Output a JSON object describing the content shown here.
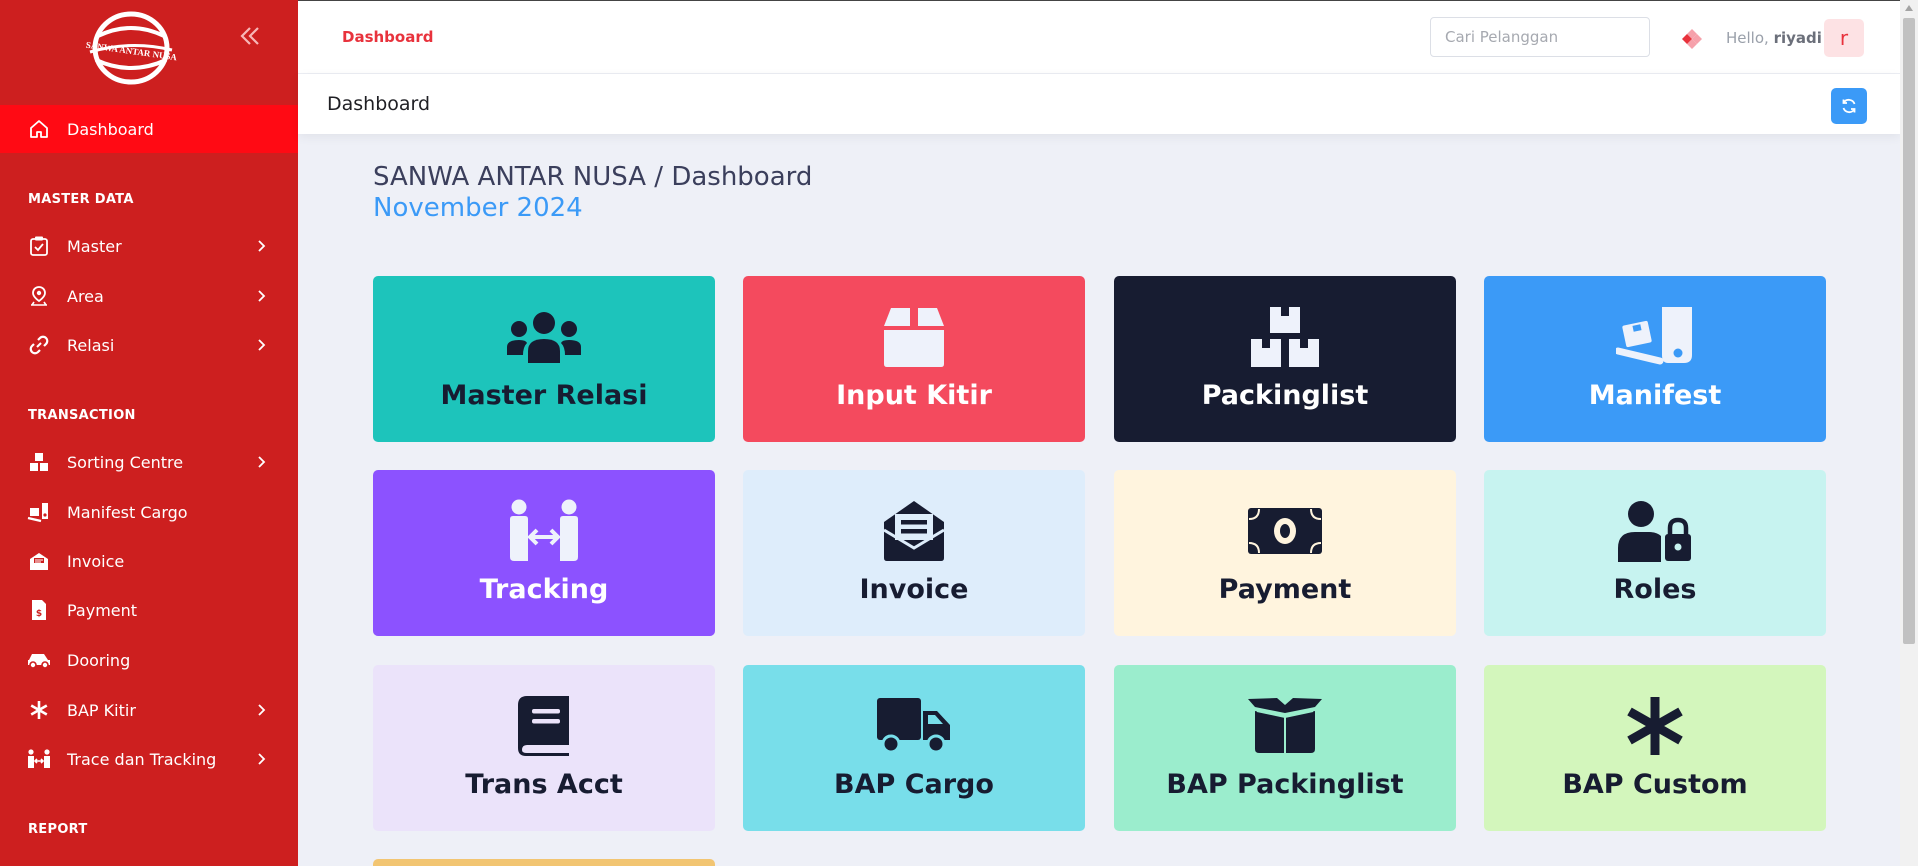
{
  "sidebar": {
    "logo_text": "SANWA ANTAR NUSA",
    "sections": {
      "master_data": "MASTER DATA",
      "transaction": "TRANSACTION",
      "report": "REPORT"
    },
    "items": {
      "dashboard": "Dashboard",
      "master": "Master",
      "area": "Area",
      "relasi": "Relasi",
      "sorting_centre": "Sorting Centre",
      "manifest_cargo": "Manifest Cargo",
      "invoice": "Invoice",
      "payment": "Payment",
      "dooring": "Dooring",
      "bap_kitir": "BAP Kitir",
      "trace_tracking": "Trace dan Tracking"
    }
  },
  "topbar": {
    "title": "Dashboard",
    "search_placeholder": "Cari Pelanggan",
    "greeting": "Hello,",
    "username": "riyadi",
    "avatar_letter": "r"
  },
  "subheader": {
    "title": "Dashboard"
  },
  "main": {
    "breadcrumb": "SANWA ANTAR NUSA / Dashboard",
    "period": "November 2024",
    "tiles": {
      "master_relasi": "Master Relasi",
      "input_kitir": "Input Kitir",
      "packinglist": "Packinglist",
      "manifest": "Manifest",
      "tracking": "Tracking",
      "invoice": "Invoice",
      "payment": "Payment",
      "roles": "Roles",
      "trans_acct": "Trans Acct",
      "bap_cargo": "BAP Cargo",
      "bap_packinglist": "BAP Packinglist",
      "bap_custom": "BAP Custom"
    }
  },
  "colors": {
    "sidebar_bg": "#cd1f1f",
    "active_item": "#ff0a14",
    "accent_blue": "#3b9af7",
    "brand_red": "#e8323c",
    "tile_master_relasi": "#1dc4bb",
    "tile_input_kitir": "#f44a5e",
    "tile_packinglist": "#171c31",
    "tile_manifest": "#3b9af7",
    "tile_tracking": "#8c52ff",
    "tile_invoice": "#deedfb",
    "tile_payment": "#fff4de",
    "tile_roles": "#c7f3f0",
    "tile_trans_acct": "#ebe3fa",
    "tile_bap_cargo": "#78deea",
    "tile_bap_packinglist": "#9bedcd",
    "tile_bap_custom": "#d3f6bc",
    "tile_partial": "#f2c572"
  }
}
